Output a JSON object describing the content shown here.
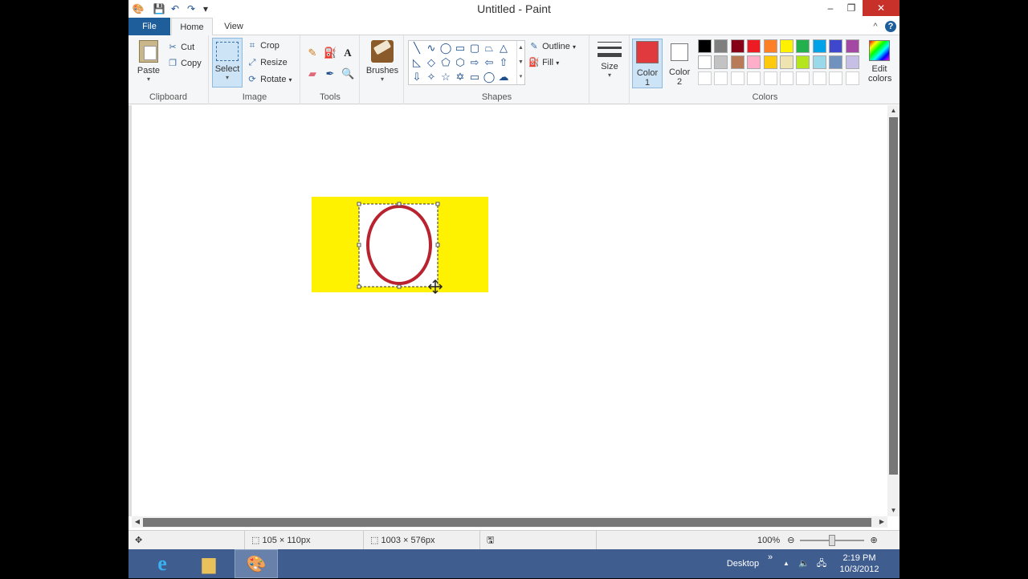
{
  "window": {
    "title": "Untitled - Paint",
    "controls": {
      "minimize": "–",
      "restore": "❐",
      "close": "✕"
    },
    "quick_access": {
      "save": "💾",
      "undo": "↶",
      "redo": "↷",
      "more": "▾"
    }
  },
  "tabs": {
    "file": "File",
    "home": "Home",
    "view": "View"
  },
  "ribbon_right": {
    "collapse": "^",
    "help": "?"
  },
  "ribbon": {
    "clipboard": {
      "label": "Clipboard",
      "paste": "Paste",
      "cut": "Cut",
      "copy": "Copy"
    },
    "image": {
      "label": "Image",
      "select": "Select",
      "crop": "Crop",
      "resize": "Resize",
      "rotate": "Rotate"
    },
    "tools": {
      "label": "Tools"
    },
    "brushes": {
      "label": "Brushes"
    },
    "shapes": {
      "label": "Shapes",
      "outline": "Outline",
      "fill": "Fill"
    },
    "size": {
      "label": "Size"
    },
    "colors": {
      "label": "Colors",
      "color1": "Color 1",
      "color2": "Color 2",
      "edit": "Edit colors",
      "color1_value": "#e03a3e",
      "color2_value": "#ffffff",
      "palette_row1": [
        "#000000",
        "#7f7f7f",
        "#880015",
        "#ed1c24",
        "#ff7f27",
        "#fff200",
        "#22b14c",
        "#00a2e8",
        "#3f48cc",
        "#a349a4"
      ],
      "palette_row2": [
        "#ffffff",
        "#c3c3c3",
        "#b97a57",
        "#ffaec9",
        "#ffc90e",
        "#efe4b0",
        "#b5e61d",
        "#99d9ea",
        "#7092be",
        "#c8bfe7"
      ]
    }
  },
  "status": {
    "selection_size": "105 × 110px",
    "image_size": "1003 × 576px",
    "zoom": "100%"
  },
  "taskbar": {
    "desktop": "Desktop",
    "time": "2:19 PM",
    "date": "10/3/2012"
  },
  "canvas_colors": {
    "rectangle": "#fff200",
    "ellipse_outline": "#b8232f"
  }
}
